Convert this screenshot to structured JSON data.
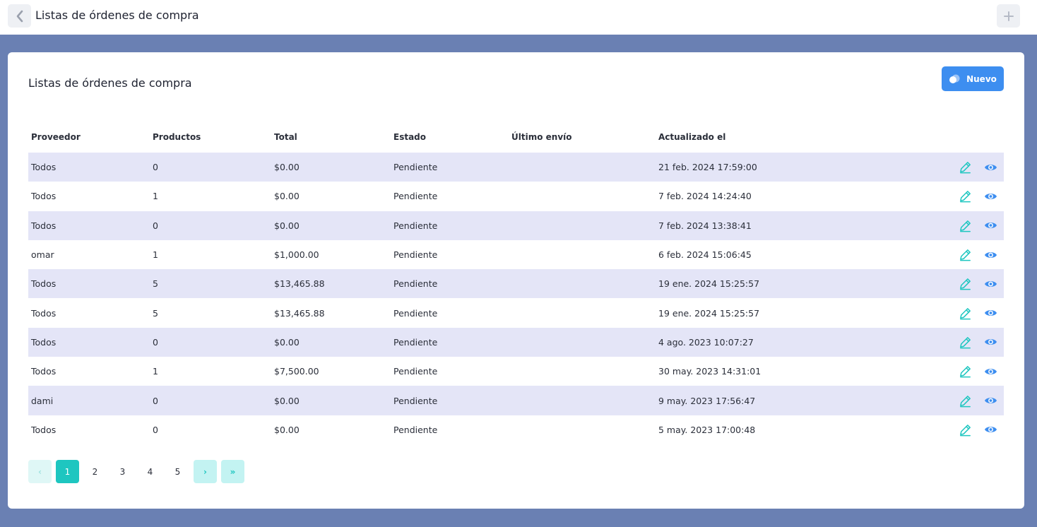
{
  "header": {
    "title": "Listas de órdenes de compra",
    "back_icon": "chevron-left-icon",
    "add_icon": "plus-icon"
  },
  "card": {
    "title": "Listas de órdenes de compra",
    "new_button": {
      "label": "Nuevo",
      "icon": "toggle-icon"
    }
  },
  "table": {
    "headers": [
      "Proveedor",
      "Productos",
      "Total",
      "Estado",
      "Último envío",
      "Actualizado el"
    ],
    "rows": [
      [
        "Todos",
        "0",
        "$0.00",
        "Pendiente",
        "",
        "21 feb. 2024 17:59:00"
      ],
      [
        "Todos",
        "1",
        "$0.00",
        "Pendiente",
        "",
        "7 feb. 2024 14:24:40"
      ],
      [
        "Todos",
        "0",
        "$0.00",
        "Pendiente",
        "",
        "7 feb. 2024 13:38:41"
      ],
      [
        "omar",
        "1",
        "$1,000.00",
        "Pendiente",
        "",
        "6 feb. 2024 15:06:45"
      ],
      [
        "Todos",
        "5",
        "$13,465.88",
        "Pendiente",
        "",
        "19 ene. 2024 15:25:57"
      ],
      [
        "Todos",
        "5",
        "$13,465.88",
        "Pendiente",
        "",
        "19 ene. 2024 15:25:57"
      ],
      [
        "Todos",
        "0",
        "$0.00",
        "Pendiente",
        "",
        "4 ago. 2023 10:07:27"
      ],
      [
        "Todos",
        "1",
        "$7,500.00",
        "Pendiente",
        "",
        "30 may. 2023 14:31:01"
      ],
      [
        "dami",
        "0",
        "$0.00",
        "Pendiente",
        "",
        "9 may. 2023 17:56:47"
      ],
      [
        "Todos",
        "0",
        "$0.00",
        "Pendiente",
        "",
        "5 may. 2023 17:00:48"
      ]
    ],
    "row_actions": [
      "edit-icon",
      "eye-icon"
    ]
  },
  "pagination": {
    "prev": "‹",
    "pages": [
      "1",
      "2",
      "3",
      "4",
      "5"
    ],
    "current": "1",
    "next": "›",
    "last": "»"
  },
  "colors": {
    "background": "#6a80b3",
    "primary": "#3d8ef0",
    "teal": "#1ec6c0",
    "row_alt": "#e4e5f7"
  }
}
